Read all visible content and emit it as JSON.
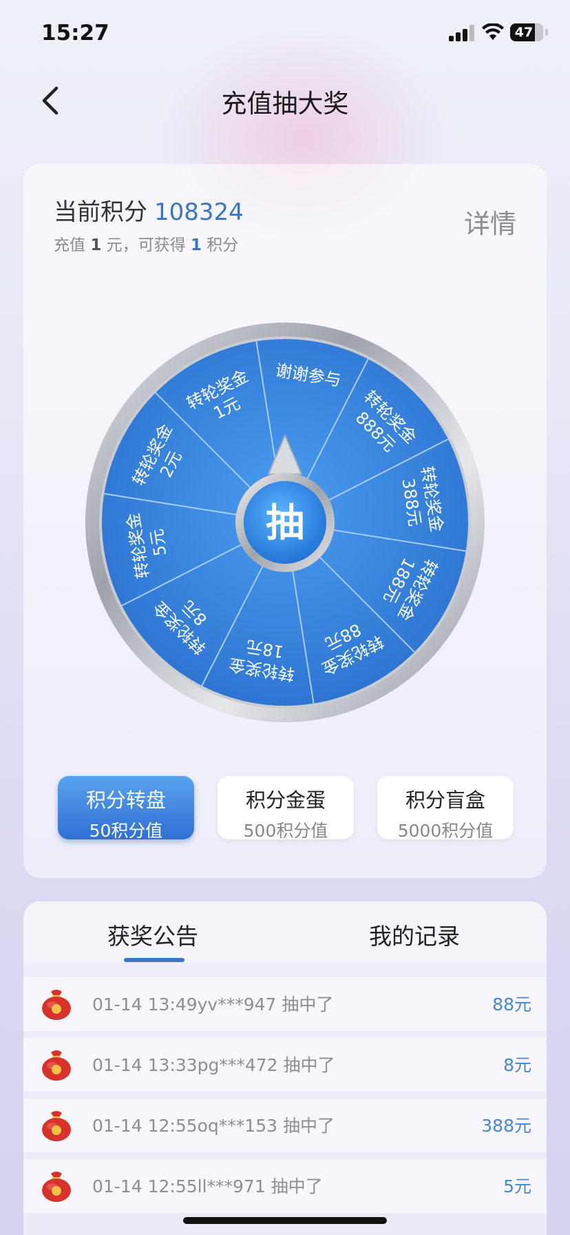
{
  "status_bar": {
    "time": "15:27",
    "battery": "47"
  },
  "header": {
    "title": "充值抽大奖"
  },
  "points": {
    "label": "当前积分",
    "value": "108324",
    "rate_prefix": "充值",
    "rate_amount": "1",
    "rate_mid": "元，可获得",
    "rate_points": "1",
    "rate_suffix": "积分",
    "details": "详情"
  },
  "wheel": {
    "center": "抽",
    "segments": [
      {
        "line1": "转轮奖金",
        "line2": "2元"
      },
      {
        "line1": "转轮奖金",
        "line2": "1元"
      },
      {
        "line1": "谢谢参与",
        "line2": ""
      },
      {
        "line1": "转轮奖金",
        "line2": "888元"
      },
      {
        "line1": "转轮奖金",
        "line2": "388元"
      },
      {
        "line1": "转轮奖金",
        "line2": "188元"
      },
      {
        "line1": "转轮奖金",
        "line2": "88元"
      },
      {
        "line1": "转轮奖金",
        "line2": "18元"
      },
      {
        "line1": "转轮奖金",
        "line2": "8元"
      },
      {
        "line1": "转轮奖金",
        "line2": "5元"
      }
    ],
    "colors": {
      "face": "#3f8ee6",
      "rim": "#b9bcc3"
    }
  },
  "modes": [
    {
      "title": "积分转盘",
      "sub": "50积分值",
      "active": true
    },
    {
      "title": "积分金蛋",
      "sub": "500积分值",
      "active": false
    },
    {
      "title": "积分盲盒",
      "sub": "5000积分值",
      "active": false
    }
  ],
  "tabs": [
    {
      "label": "获奖公告",
      "active": true
    },
    {
      "label": "我的记录",
      "active": false
    }
  ],
  "announcements": [
    {
      "text": "01-14 13:49yv***947 抽中了",
      "amount": "88元"
    },
    {
      "text": "01-14 13:33pg***472 抽中了",
      "amount": "8元"
    },
    {
      "text": "01-14 12:55oq***153 抽中了",
      "amount": "388元"
    },
    {
      "text": "01-14 12:55ll***971 抽中了",
      "amount": "5元"
    }
  ]
}
